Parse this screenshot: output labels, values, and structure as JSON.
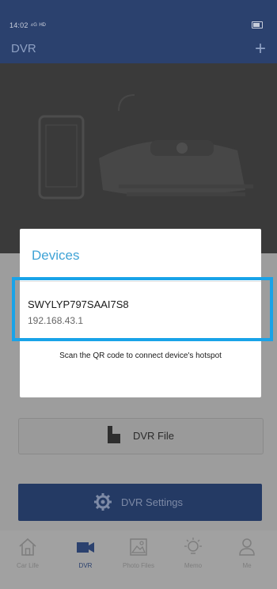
{
  "status": {
    "time": "14:02 ⁴ᴳ ᴴᴰ"
  },
  "appbar": {
    "title": "DVR",
    "add_icon": "plus-icon"
  },
  "dialog": {
    "title": "Devices",
    "device": {
      "name": "SWYLYP797SAAI7S8",
      "ip": "192.168.43.1"
    },
    "qr_text": "Scan the QR code to connect device's hotspot"
  },
  "buttons": {
    "dvr_file": "DVR File",
    "dvr_settings": "DVR Settings"
  },
  "nav": {
    "items": [
      {
        "label": "Car Life",
        "icon": "home-icon"
      },
      {
        "label": "DVR",
        "icon": "camera-icon"
      },
      {
        "label": "Photo Files",
        "icon": "gallery-icon"
      },
      {
        "label": "Memo",
        "icon": "bulb-icon"
      },
      {
        "label": "Me",
        "icon": "person-icon"
      }
    ]
  },
  "colors": {
    "appbar": "#2b416e",
    "accent": "#3fa3d6",
    "highlight": "#19a3e8"
  }
}
